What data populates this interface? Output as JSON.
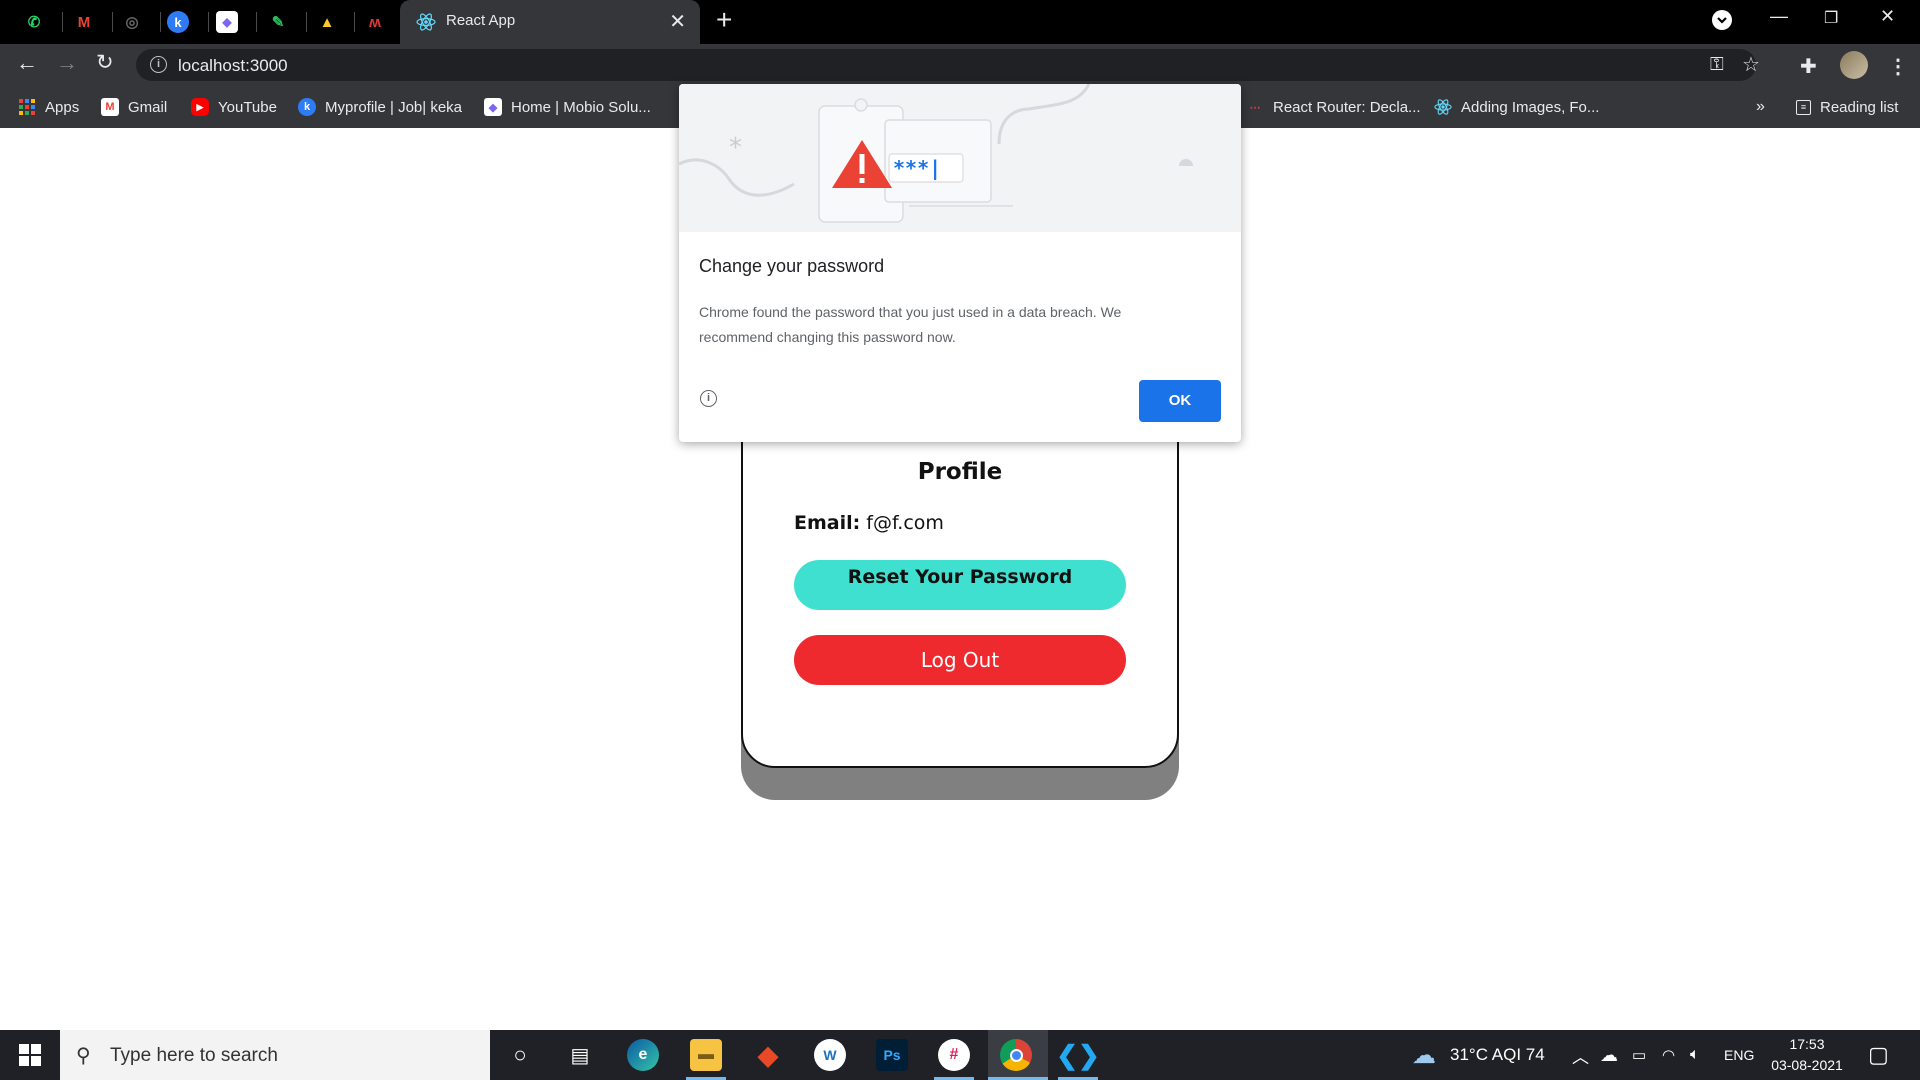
{
  "browser": {
    "active_tab_title": "React App",
    "url": "localhost:3000",
    "pinned_tabs": [
      {
        "icon": "whatsapp-icon",
        "glyph": "✆",
        "color": "#25d366"
      },
      {
        "icon": "gmail-icon",
        "glyph": "M",
        "color": "#ea4335"
      },
      {
        "icon": "github-icon",
        "glyph": "◎",
        "color": "#555555"
      },
      {
        "icon": "keka-icon",
        "glyph": "k",
        "color": "#2e7bf6"
      },
      {
        "icon": "clickup-icon",
        "glyph": "◆",
        "color": "#7b68ee"
      },
      {
        "icon": "evernote-icon",
        "glyph": "✎",
        "color": "#2dbe60"
      },
      {
        "icon": "firebase-icon",
        "glyph": "▲",
        "color": "#ffca28"
      },
      {
        "icon": "mobio-icon",
        "glyph": "ʍ",
        "color": "#e53935"
      }
    ]
  },
  "bookmarks": {
    "items": [
      {
        "label": "Apps",
        "icon": "apps-grid-icon"
      },
      {
        "label": "Gmail",
        "icon": "gmail-icon"
      },
      {
        "label": "YouTube",
        "icon": "youtube-icon"
      },
      {
        "label": "Myprofile | Job| keka",
        "icon": "keka-icon"
      },
      {
        "label": "Home | Mobio Solu...",
        "icon": "mobio-icon"
      },
      {
        "label": "React Router: Decla...",
        "icon": "react-router-icon"
      },
      {
        "label": "Adding Images, Fo...",
        "icon": "react-icon"
      }
    ],
    "overflow": "»",
    "reading_list": "Reading list"
  },
  "page": {
    "profile_title": "Profile",
    "email_label": "Email:",
    "email_value": "f@f.com",
    "reset_button": "Reset Your Password",
    "logout_button": "Log Out"
  },
  "dialog": {
    "title": "Change your password",
    "body": "Chrome found the password that you just used in a data breach. We recommend changing this password now.",
    "ok_button": "OK",
    "illustration_text": "***|"
  },
  "taskbar": {
    "search_placeholder": "Type here to search",
    "weather": "31°C  AQI 74",
    "language": "ENG",
    "time": "17:53",
    "date": "03-08-2021"
  },
  "colors": {
    "reset_button": "#40e0d0",
    "logout_button": "#ee2a2f",
    "ok_button": "#1a73e8",
    "avatar_gradient_start": "#3cb1e6",
    "avatar_gradient_end": "#49d1c0"
  }
}
